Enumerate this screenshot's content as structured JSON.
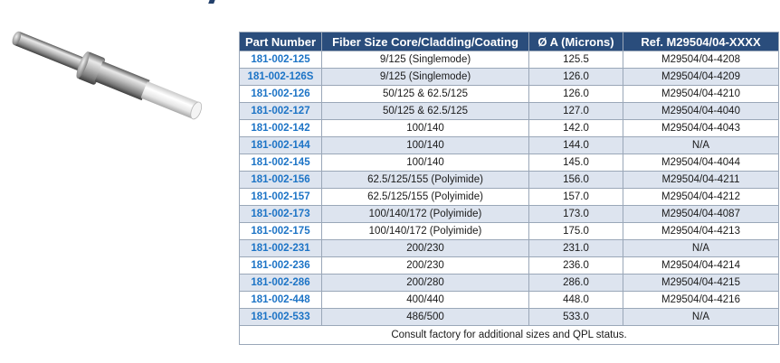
{
  "table": {
    "headers": [
      "Part Number",
      "Fiber Size Core/Cladding/Coating",
      "Ø A (Microns)",
      "Ref. M29504/04-XXXX"
    ],
    "rows": [
      [
        "181-002-125",
        "9/125 (Singlemode)",
        "125.5",
        "M29504/04-4208"
      ],
      [
        "181-002-126S",
        "9/125 (Singlemode)",
        "126.0",
        "M29504/04-4209"
      ],
      [
        "181-002-126",
        "50/125 & 62.5/125",
        "126.0",
        "M29504/04-4210"
      ],
      [
        "181-002-127",
        "50/125 & 62.5/125",
        "127.0",
        "M29504/04-4040"
      ],
      [
        "181-002-142",
        "100/140",
        "142.0",
        "M29504/04-4043"
      ],
      [
        "181-002-144",
        "100/140",
        "144.0",
        "N/A"
      ],
      [
        "181-002-145",
        "100/140",
        "145.0",
        "M29504/04-4044"
      ],
      [
        "181-002-156",
        "62.5/125/155 (Polyimide)",
        "156.0",
        "M29504/04-4211"
      ],
      [
        "181-002-157",
        "62.5/125/155 (Polyimide)",
        "157.0",
        "M29504/04-4212"
      ],
      [
        "181-002-173",
        "100/140/172 (Polyimide)",
        "173.0",
        "M29504/04-4087"
      ],
      [
        "181-002-175",
        "100/140/172 (Polyimide)",
        "175.0",
        "M29504/04-4213"
      ],
      [
        "181-002-231",
        "200/230",
        "231.0",
        "N/A"
      ],
      [
        "181-002-236",
        "200/230",
        "236.0",
        "M29504/04-4214"
      ],
      [
        "181-002-286",
        "200/280",
        "286.0",
        "M29504/04-4215"
      ],
      [
        "181-002-448",
        "400/440",
        "448.0",
        "M29504/04-4216"
      ],
      [
        "181-002-533",
        "486/500",
        "533.0",
        "N/A"
      ]
    ],
    "footnote": "Consult factory for additional sizes and QPL status."
  },
  "colors": {
    "header_bg": "#2a4d7c",
    "alt_row_bg": "#dde4ef",
    "part_number_text": "#1d74c6"
  }
}
